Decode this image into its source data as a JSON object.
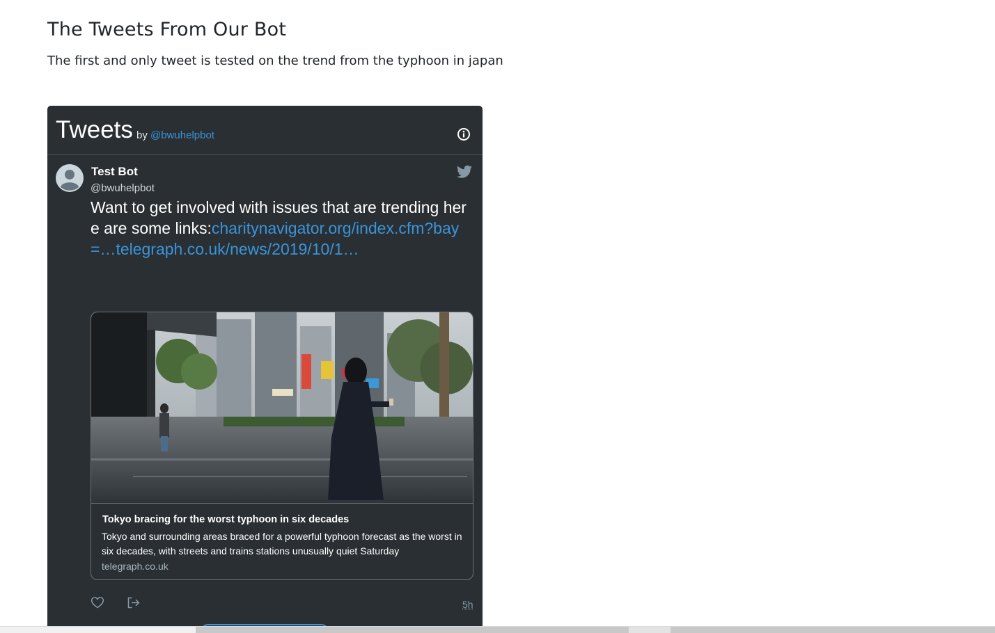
{
  "page": {
    "title": "The Tweets From Our Bot",
    "description": "The first and only tweet is tested on the trend from the typhoon in japan"
  },
  "timeline": {
    "title": "Tweets",
    "by_label": "by",
    "handle": "@bwuhelpbot",
    "info_icon": "info-icon"
  },
  "tweet": {
    "author_name": "Test Bot",
    "author_handle": "@bwuhelpbot",
    "text_prefix": "Want to get involved with issues that are trending here are some links:",
    "link_1": "charitynavigator.org/index.cfm?bay=…",
    "link_2": "telegraph.co.uk/news/2019/10/1…",
    "card": {
      "title": "Tokyo bracing for the worst typhoon in six decades",
      "description": "Tokyo and surrounding areas braced for a powerful typhoon forecast as the worst in six decades, with streets and trains stations unusually quiet Saturday",
      "domain": "telegraph.co.uk"
    },
    "timestamp": "5h"
  },
  "colors": {
    "timeline_bg": "#292f33",
    "link": "#3b94d9",
    "muted": "#8899a6"
  }
}
